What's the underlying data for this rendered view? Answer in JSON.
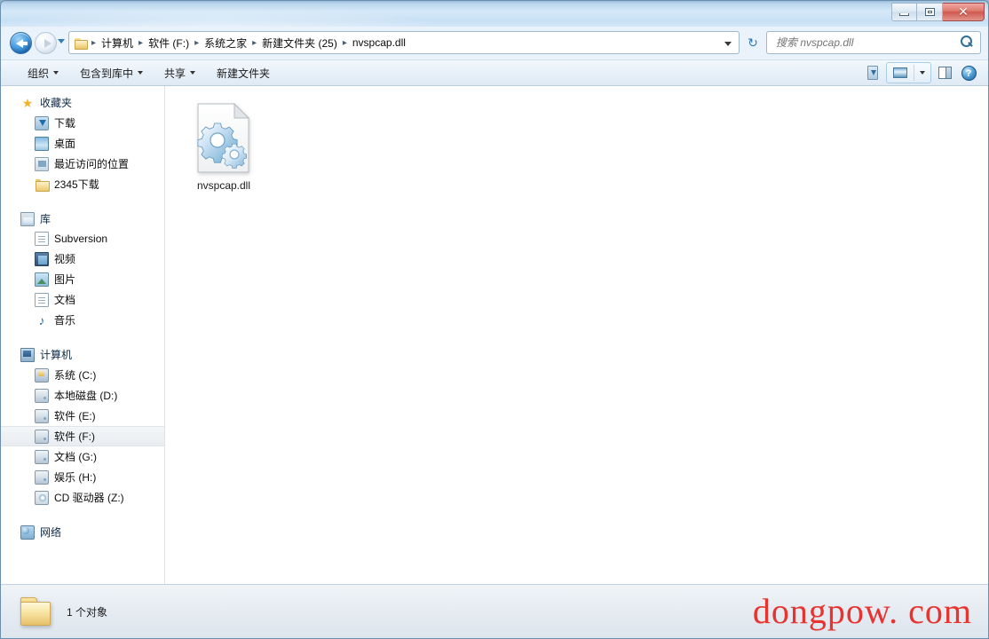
{
  "window": {
    "title": "",
    "controls": {
      "minimize": "–",
      "maximize": "□",
      "close": "✕"
    }
  },
  "address": {
    "folder_icon": "folder-icon",
    "crumbs": [
      "计算机",
      "软件 (F:)",
      "系统之家",
      "新建文件夹 (25)",
      "nvspcap.dll"
    ],
    "separator": "▸",
    "dropdown": "chevron-down-icon",
    "refresh_label": "↻"
  },
  "search": {
    "placeholder": "搜索 nvspcap.dll",
    "value": "",
    "icon": "search-icon"
  },
  "toolbar": {
    "items": [
      {
        "label": "组织",
        "has_caret": true
      },
      {
        "label": "包含到库中",
        "has_caret": true
      },
      {
        "label": "共享",
        "has_caret": true
      },
      {
        "label": "新建文件夹",
        "has_caret": false
      }
    ],
    "right_buttons": [
      {
        "name": "burn-icon",
        "title": "刻录"
      },
      {
        "name": "view-mode-icon",
        "title": "更改您的视图"
      },
      {
        "name": "view-mode-dropdown-icon",
        "title": "更多选项"
      },
      {
        "name": "preview-pane-icon",
        "title": "显示预览窗格"
      },
      {
        "name": "help-icon",
        "title": "获取帮助",
        "glyph": "?"
      }
    ]
  },
  "sidebar": {
    "groups": [
      {
        "head": {
          "label": "收藏夹",
          "icon": "star-icon"
        },
        "items": [
          {
            "label": "下载",
            "icon": "downloads-icon",
            "selected": false
          },
          {
            "label": "桌面",
            "icon": "desktop-icon",
            "selected": false
          },
          {
            "label": "最近访问的位置",
            "icon": "recent-places-icon",
            "selected": false
          },
          {
            "label": "2345下载",
            "icon": "folder-icon",
            "selected": false
          }
        ]
      },
      {
        "head": {
          "label": "库",
          "icon": "library-icon"
        },
        "items": [
          {
            "label": "Subversion",
            "icon": "document-icon",
            "selected": false
          },
          {
            "label": "视频",
            "icon": "video-icon",
            "selected": false
          },
          {
            "label": "图片",
            "icon": "picture-icon",
            "selected": false
          },
          {
            "label": "文档",
            "icon": "document-icon",
            "selected": false
          },
          {
            "label": "音乐",
            "icon": "music-icon",
            "selected": false
          }
        ]
      },
      {
        "head": {
          "label": "计算机",
          "icon": "computer-icon"
        },
        "items": [
          {
            "label": "系统 (C:)",
            "icon": "system-drive-icon",
            "selected": false
          },
          {
            "label": "本地磁盘 (D:)",
            "icon": "drive-icon",
            "selected": false
          },
          {
            "label": "软件 (E:)",
            "icon": "drive-icon",
            "selected": false
          },
          {
            "label": "软件 (F:)",
            "icon": "drive-icon",
            "selected": true
          },
          {
            "label": "文档 (G:)",
            "icon": "drive-icon",
            "selected": false
          },
          {
            "label": "娱乐 (H:)",
            "icon": "drive-icon",
            "selected": false
          },
          {
            "label": "CD 驱动器 (Z:)",
            "icon": "cd-drive-icon",
            "selected": false
          }
        ]
      },
      {
        "head": {
          "label": "网络",
          "icon": "network-icon"
        },
        "items": []
      }
    ]
  },
  "files": [
    {
      "name": "nvspcap.dll",
      "icon": "dll-gear-icon"
    }
  ],
  "status": {
    "icon": "folder-icon",
    "text": "1 个对象"
  },
  "watermark": {
    "text": "dongpow. com",
    "color": "#e8332f"
  }
}
